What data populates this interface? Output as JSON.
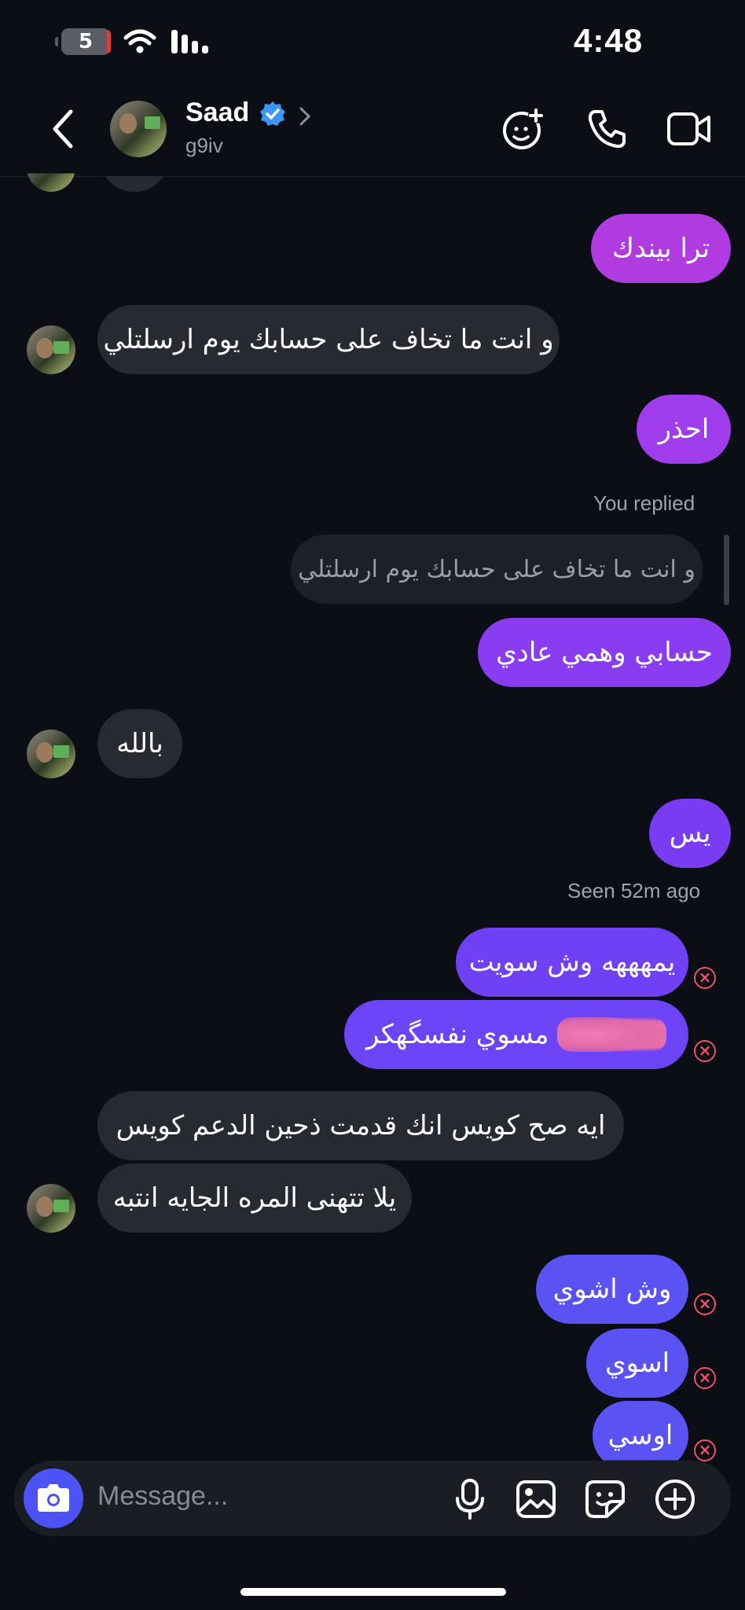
{
  "status_bar": {
    "battery": "5",
    "time": "4:48"
  },
  "header": {
    "name": "Saad",
    "username": "g9iv"
  },
  "messages": {
    "m1": "ترا بيندك",
    "m2": "و انت ما تخاف على حسابك يوم ارسلتلي",
    "m3": "احذر",
    "reply_label": "You replied",
    "reply_quote": "و انت ما تخاف على حسابك يوم ارسلتلي",
    "m4": "حسابي وهمي عادي",
    "m5": "بالله",
    "m6": "يس",
    "seen": "Seen 52m ago",
    "m7": "يمهههه وش سويت",
    "m8": "مسوي نفسگهكر",
    "m9": "ايه صح كويس انك قدمت ذحين الدعم كويس",
    "m10": "يلا تتهنى المره الجايه انتبه",
    "m11": "وش اشوي",
    "m12": "اسوي",
    "m13": "اوسي"
  },
  "composer": {
    "placeholder": "Message..."
  },
  "colors": {
    "background": "#0b0e14",
    "incoming": "#262a31",
    "outgoing_pink": "#b03be0",
    "outgoing_purple": "#7a3cf2",
    "outgoing_indigo": "#5a52f3",
    "error": "#f0506a",
    "verified": "#3b97f3"
  }
}
